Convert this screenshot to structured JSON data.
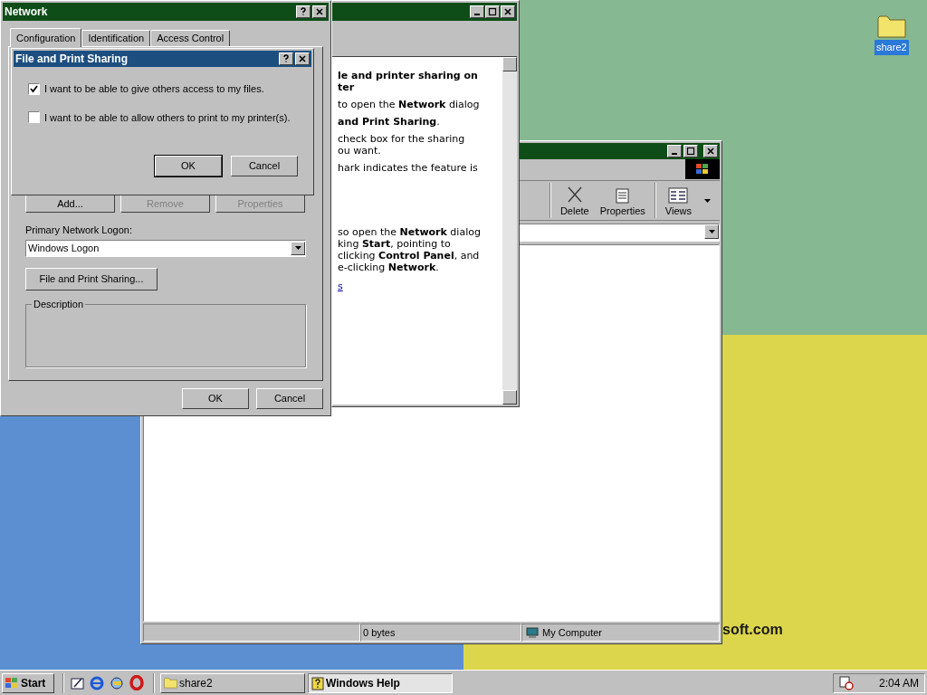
{
  "desktop": {
    "icons": [
      {
        "label": "share2",
        "selected": true
      }
    ],
    "wallpaper_text": "soft.com"
  },
  "explorer": {
    "toolbar": [
      {
        "label": "Delete",
        "kind": "delete"
      },
      {
        "label": "Properties",
        "kind": "properties"
      },
      {
        "label": "Views",
        "kind": "views"
      }
    ],
    "status_bar": [
      "0 bytes",
      "My Computer"
    ]
  },
  "help": {
    "paragraphs": [
      {
        "kind": "heading",
        "lines": [
          "le and printer sharing on",
          "ter"
        ]
      },
      {
        "kind": "text",
        "lines": [
          "to open the **Network** dialog"
        ]
      },
      {
        "kind": "text",
        "lines": [
          "**and Print Sharing**."
        ]
      },
      {
        "kind": "text",
        "lines": [
          "check box for the sharing",
          "ou want."
        ]
      },
      {
        "kind": "text",
        "lines": [
          "hark indicates the feature is"
        ]
      },
      {
        "kind": "tip",
        "lines": [
          "so open the **Network** dialog",
          "king **Start**, pointing to",
          "clicking **Control Panel**, and",
          "e-clicking **Network**."
        ]
      },
      {
        "kind": "link",
        "lines": [
          "s"
        ]
      }
    ]
  },
  "network": {
    "title": "Network",
    "tabs": [
      {
        "label": "Configuration",
        "selected": true
      },
      {
        "label": "Identification",
        "selected": false
      },
      {
        "label": "Access Control",
        "selected": false
      }
    ],
    "buttons": [
      {
        "label": "Add...",
        "disabled": false
      },
      {
        "label": "Remove",
        "disabled": true
      },
      {
        "label": "Properties",
        "disabled": true
      }
    ],
    "logon_label": "Primary Network Logon:",
    "logon_value": "Windows Logon",
    "sharing_button": "File and Print Sharing...",
    "description_label": "Description",
    "footer_buttons": [
      "OK",
      "Cancel"
    ]
  },
  "sharing_dialog": {
    "title": "File and Print Sharing",
    "options": [
      {
        "label": "I want to be able to give others access to my files.",
        "checked": true
      },
      {
        "label": "I want to be able to allow others to print to my printer(s).",
        "checked": false
      }
    ],
    "buttons": [
      "OK",
      "Cancel"
    ]
  },
  "taskbar": {
    "start": "Start",
    "tasks": [
      {
        "label": "share2",
        "selected": false,
        "kind": "folder"
      },
      {
        "label": "Windows Help",
        "selected": true,
        "kind": "help"
      }
    ],
    "clock": "2:04 AM"
  }
}
